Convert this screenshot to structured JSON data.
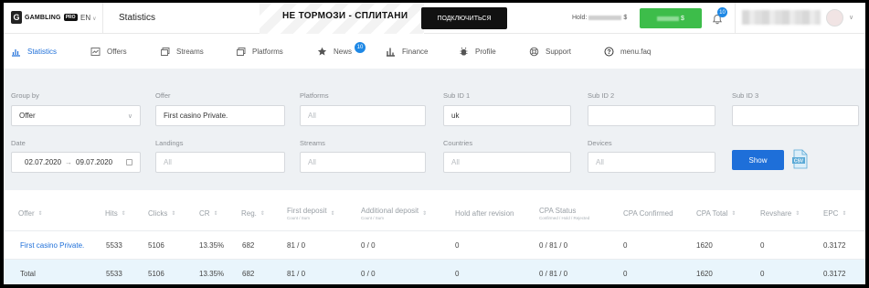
{
  "header": {
    "logo_text": "GAMBLING",
    "logo_pro": "PRO",
    "language": "EN",
    "page_title": "Statistics",
    "promo_text": "НЕ ТОРМОЗИ - СПЛИТАНИ",
    "promo_button": "ПОДКЛЮЧИТЬСЯ",
    "hold_label": "Hold:",
    "currency": "$",
    "notifications_count": "10"
  },
  "nav": {
    "items": [
      {
        "label": "Statistics",
        "icon": "bar-chart-icon",
        "active": true
      },
      {
        "label": "Offers",
        "icon": "offers-icon"
      },
      {
        "label": "Streams",
        "icon": "streams-icon"
      },
      {
        "label": "Platforms",
        "icon": "platforms-icon"
      },
      {
        "label": "News",
        "icon": "star-icon",
        "badge": "10"
      },
      {
        "label": "Finance",
        "icon": "finance-icon"
      },
      {
        "label": "Profile",
        "icon": "profile-icon"
      },
      {
        "label": "Support",
        "icon": "support-icon"
      },
      {
        "label": "menu.faq",
        "icon": "help-icon"
      }
    ]
  },
  "filters": {
    "group_by": {
      "label": "Group by",
      "value": "Offer"
    },
    "offer": {
      "label": "Offer",
      "value": "First casino Private."
    },
    "platforms": {
      "label": "Platforms",
      "placeholder": "All"
    },
    "sub_id_1": {
      "label": "Sub ID 1",
      "value": "uk"
    },
    "sub_id_2": {
      "label": "Sub ID 2",
      "value": ""
    },
    "sub_id_3": {
      "label": "Sub ID 3",
      "value": ""
    },
    "date": {
      "label": "Date",
      "from": "02.07.2020",
      "sep": "→",
      "to": "09.07.2020"
    },
    "landings": {
      "label": "Landings",
      "placeholder": "All"
    },
    "streams": {
      "label": "Streams",
      "placeholder": "All"
    },
    "countries": {
      "label": "Countries",
      "placeholder": "All"
    },
    "devices": {
      "label": "Devices",
      "placeholder": "All"
    },
    "show_button": "Show",
    "csv_label": "CSV"
  },
  "table": {
    "columns": [
      {
        "label": "Offer",
        "sortable": true
      },
      {
        "label": "Hits",
        "sortable": true
      },
      {
        "label": "Clicks",
        "sortable": true
      },
      {
        "label": "CR",
        "sortable": true
      },
      {
        "label": "Reg.",
        "sortable": true
      },
      {
        "label": "First deposit",
        "sub": "Count / Sum",
        "sortable": true
      },
      {
        "label": "Additional deposit",
        "sub": "Count / Sum",
        "sortable": true
      },
      {
        "label": "Hold after revision",
        "sortable": false
      },
      {
        "label": "CPA Status",
        "sub": "Confirmed / Hold / Rejected",
        "sortable": false
      },
      {
        "label": "CPA Confirmed",
        "sortable": false
      },
      {
        "label": "CPA Total",
        "sortable": true
      },
      {
        "label": "Revshare",
        "sortable": true
      },
      {
        "label": "EPC",
        "sortable": true
      }
    ],
    "rows": [
      [
        "First casino Private.",
        "5533",
        "5106",
        "13.35%",
        "682",
        "81 / 0",
        "0 / 0",
        "0",
        "0 / 81 / 0",
        "0",
        "1620",
        "0",
        "0.3172"
      ],
      [
        "Total",
        "5533",
        "5106",
        "13.35%",
        "682",
        "81 / 0",
        "0 / 0",
        "0",
        "0 / 81 / 0",
        "0",
        "1620",
        "0",
        "0.3172"
      ]
    ]
  }
}
